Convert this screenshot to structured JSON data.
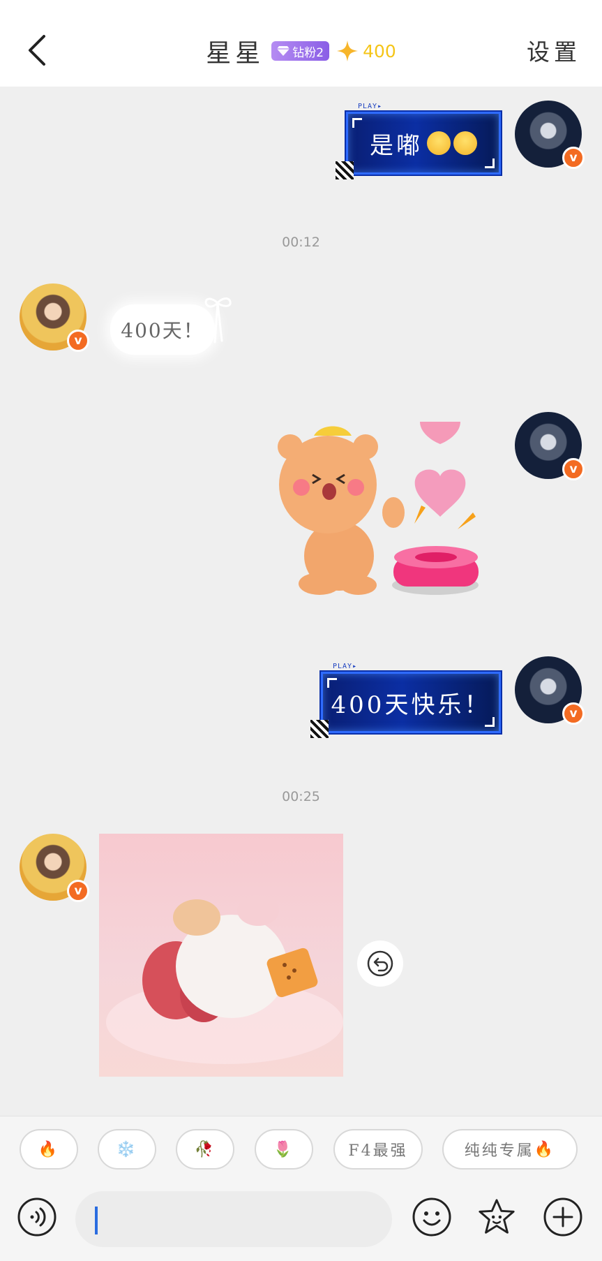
{
  "header": {
    "back_icon": "chevron-left-icon",
    "title": "星星",
    "fan_badge": {
      "icon": "diamond-icon",
      "label": "钻粉2",
      "color": "#9b6ff0"
    },
    "points": {
      "icon": "sparkle-star-icon",
      "value": "400",
      "color": "#f5c518"
    },
    "settings_label": "设置"
  },
  "messages": [
    {
      "side": "right",
      "type": "text",
      "style": "cyber-blue",
      "text": "是嘟",
      "emoji": [
        "praying-face-emoji",
        "praying-face-emoji"
      ]
    },
    {
      "type": "timestamp",
      "text": "00:12"
    },
    {
      "side": "left",
      "type": "text",
      "style": "cloud-white",
      "text": "400天！"
    },
    {
      "side": "right",
      "type": "sticker",
      "sticker": "bear-pressing-heart-button"
    },
    {
      "side": "right",
      "type": "text",
      "style": "cyber-blue",
      "text": "400天快乐！"
    },
    {
      "type": "timestamp",
      "text": "00:25"
    },
    {
      "side": "left",
      "type": "image",
      "sticker": "flying-felt-bunny"
    }
  ],
  "withdraw_icon": "undo-arrow-icon",
  "quick_replies": [
    {
      "label": "",
      "emoji": "🔥"
    },
    {
      "label": "",
      "emoji": "❄️"
    },
    {
      "label": "",
      "emoji": "🥀"
    },
    {
      "label": "",
      "emoji": "🌷"
    },
    {
      "label": "F4最强",
      "emoji": ""
    },
    {
      "label": "纯纯专属",
      "emoji": "🔥"
    }
  ],
  "input_bar": {
    "voice_icon": "voice-wave-icon",
    "input_value": "",
    "emoji_icon": "smiley-icon",
    "sticker_icon": "star-face-icon",
    "more_icon": "plus-circle-icon",
    "caret_color": "#2a6ce0"
  },
  "colors": {
    "background": "#efefef",
    "header": "#ffffff",
    "verified_badge": "#f36b22",
    "bubble_blue": "#0b2ea3"
  }
}
